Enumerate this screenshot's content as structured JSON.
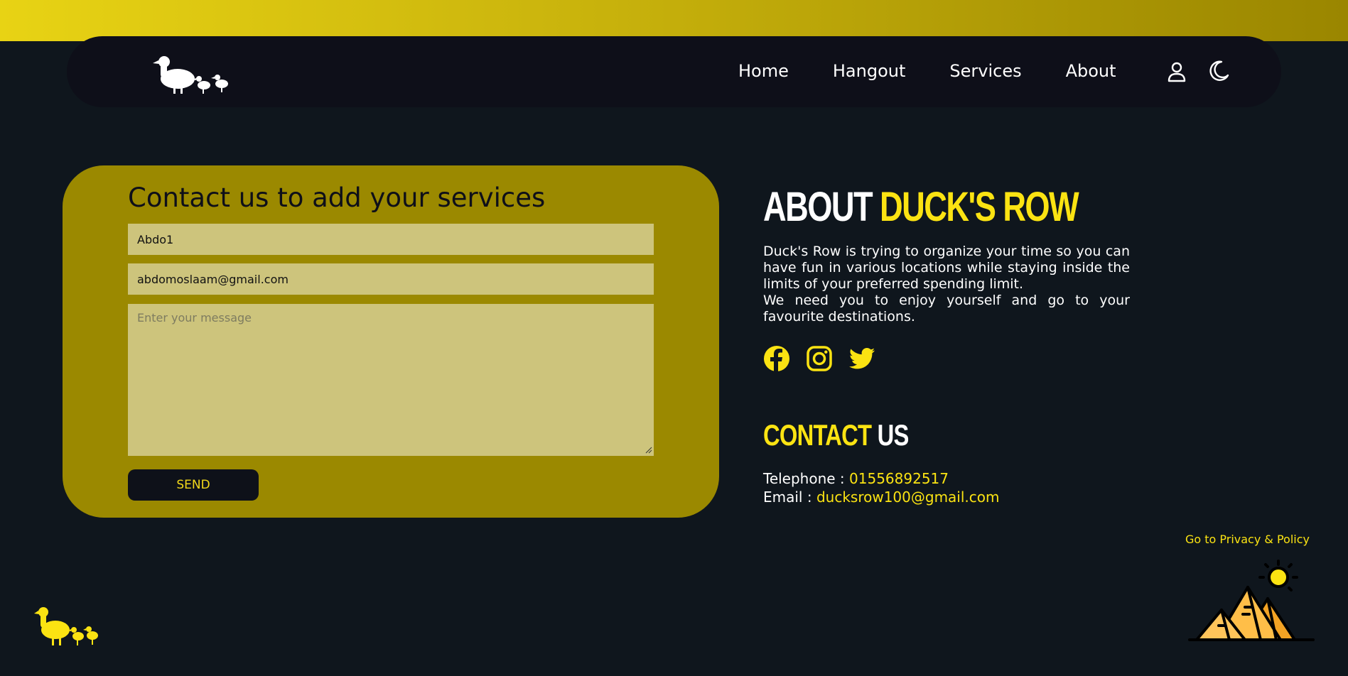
{
  "nav": {
    "logo_icon": "duck-family-logo",
    "links": [
      "Home",
      "Hangout",
      "Services",
      "About"
    ],
    "user_icon": "user-icon",
    "theme_icon": "moon-icon"
  },
  "contact_form": {
    "title": "Contact us to add your services",
    "name_value": "Abdo1",
    "email_value": "abdomoslaam@gmail.com",
    "message_placeholder": "Enter your message",
    "send_label": "SEND"
  },
  "about": {
    "title_prefix": "ABOUT ",
    "title_highlight": "DUCK'S ROW",
    "paragraph_1": "Duck's Row is trying to organize your time so you can have fun in various locations while staying inside the limits of your preferred spending limit.",
    "paragraph_2": "We need you to enjoy yourself and go to your favourite destinations.",
    "socials": [
      "facebook-icon",
      "instagram-icon",
      "twitter-icon"
    ]
  },
  "contact_info": {
    "title_highlight": "CONTACT",
    "title_suffix": " US",
    "telephone_label": "Telephone : ",
    "telephone_value": "01556892517",
    "email_label": "Email : ",
    "email_value": "ducksrow100@gmail.com"
  },
  "footer": {
    "privacy_link": "Go to Privacy & Policy",
    "logo_icon": "duck-family-logo",
    "illustration": "pyramids-sun-icon"
  },
  "colors": {
    "accent_yellow": "#fbe312",
    "card_olive": "#9b8900",
    "background": "#0f161d",
    "navbar": "#0e0f19",
    "field": "#cdc47c"
  }
}
